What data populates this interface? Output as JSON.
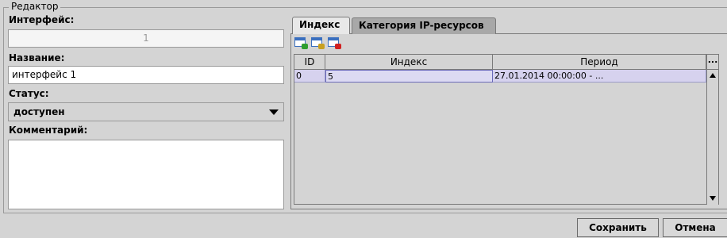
{
  "editor": {
    "legend": "Редактор",
    "interface_label": "Интерфейс:",
    "interface_value": "1",
    "name_label": "Название:",
    "name_value": "интерфейс 1",
    "status_label": "Статус:",
    "status_value": "доступен",
    "comment_label": "Комментарий:",
    "comment_value": ""
  },
  "tabs": [
    {
      "label": "Индекс",
      "active": true
    },
    {
      "label": "Категория IP-ресурсов",
      "active": false
    }
  ],
  "toolbar": {
    "icons": [
      "add-row-icon",
      "edit-row-icon",
      "delete-row-icon"
    ]
  },
  "table": {
    "columns": [
      "ID",
      "Индекс",
      "Период"
    ],
    "more_label": "...",
    "rows": [
      {
        "id": "0",
        "index": "5",
        "period": "27.01.2014 00:00:00 - ..."
      }
    ]
  },
  "buttons": {
    "save": "Сохранить",
    "cancel": "Отмена"
  },
  "colors": {
    "selected_row": "#d6d2ee",
    "add_badge": "#2e9e2e",
    "edit_badge": "#c8a020",
    "delete_badge": "#d02020"
  }
}
